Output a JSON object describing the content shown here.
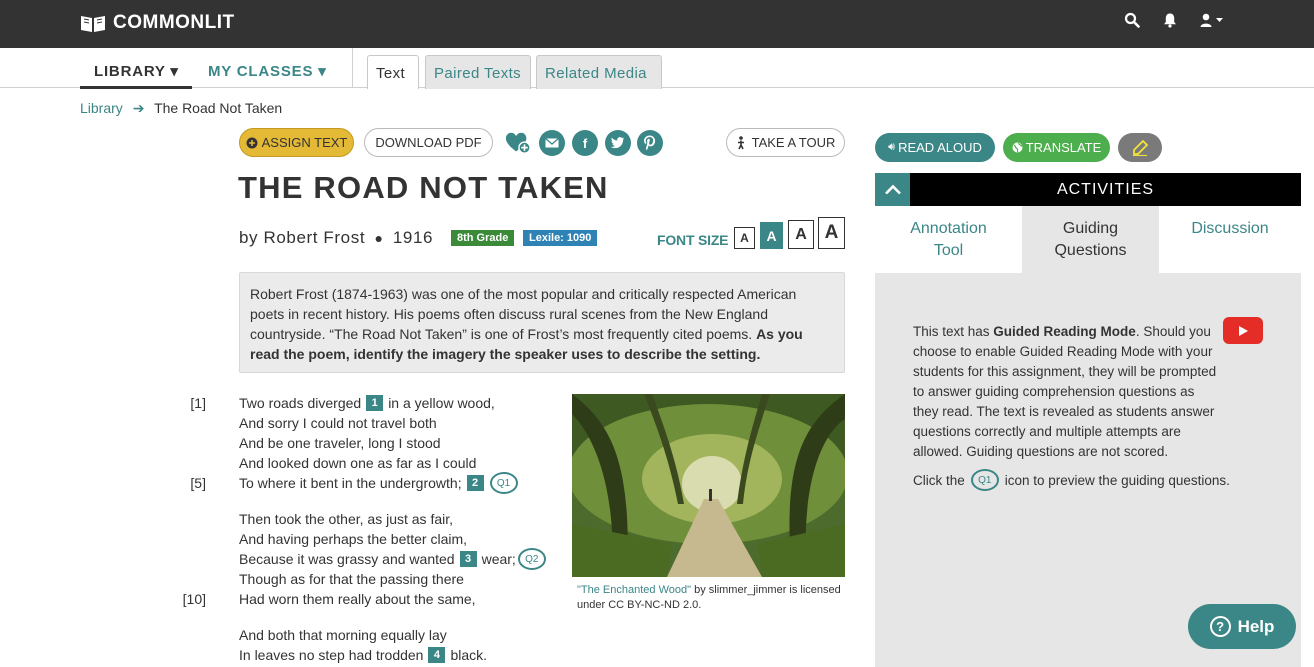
{
  "header": {
    "logo_text": "COMMONLIT",
    "icons": [
      "search-icon",
      "bell-icon",
      "user-icon"
    ]
  },
  "nav": {
    "library": "LIBRARY",
    "my_classes": "MY CLASSES",
    "tabs": [
      "Text",
      "Paired Texts",
      "Related Media"
    ]
  },
  "breadcrumb": {
    "library": "Library",
    "current": "The Road Not Taken"
  },
  "toolbar": {
    "assign": "ASSIGN TEXT",
    "download": "DOWNLOAD PDF",
    "tour": "TAKE A TOUR",
    "social": [
      "heart-plus-icon",
      "email-icon",
      "facebook-icon",
      "twitter-icon",
      "pinterest-icon"
    ]
  },
  "text": {
    "title": "THE ROAD NOT TAKEN",
    "byline": "by Robert Frost",
    "year": "1916",
    "grade": "8th Grade",
    "lexile": "Lexile: 1090",
    "font_size_label": "FONT SIZE",
    "font_size_options": [
      "A",
      "A",
      "A",
      "A"
    ],
    "intro_plain": "Robert Frost (1874-1963) was one of the most popular and critically respected American poets in recent history. His poems often discuss rural scenes from the New England countryside. “The Road Not Taken” is one of Frost’s most frequently cited poems. ",
    "intro_bold": "As you read the poem, identify the imagery the speaker uses to describe the setting."
  },
  "poem": {
    "line_numbers": [
      "[1]",
      "[5]",
      "[10]"
    ],
    "lines": [
      {
        "before": "Two roads diverged",
        "vocab": "1",
        "after": "in a yellow wood,"
      },
      {
        "before": "And sorry I could not travel both"
      },
      {
        "before": "And be one traveler, long I stood"
      },
      {
        "before": "And looked down one as far as I could"
      },
      {
        "before": "To where it bent in the undergrowth;",
        "vocab": "2",
        "question": "Q1"
      },
      {
        "before": "Then took the other, as just as fair,"
      },
      {
        "before": "And having perhaps the better claim,"
      },
      {
        "before": "Because it was grassy and wanted",
        "vocab": "3",
        "after": "wear;",
        "question": "Q2"
      },
      {
        "before": "Though as for that the passing there"
      },
      {
        "before": "Had worn them really about the same,"
      },
      {
        "before": "And both that morning equally lay"
      },
      {
        "before": "In leaves no step had trodden",
        "vocab": "4",
        "after": "black."
      }
    ]
  },
  "image": {
    "caption_link": "\"The Enchanted Wood\"",
    "caption_rest": " by slimmer_jimmer is licensed under CC BY-NC-ND 2.0."
  },
  "tools": {
    "read_aloud": "READ ALOUD",
    "translate": "TRANSLATE"
  },
  "activities": {
    "header": "ACTIVITIES",
    "tabs": [
      "Annotation Tool",
      "Guiding Questions",
      "Discussion"
    ],
    "tab_lines": [
      [
        "Annotation",
        "Tool"
      ],
      [
        "Guiding",
        "Questions"
      ],
      [
        "Discussion"
      ]
    ],
    "gr_pre": "This text has ",
    "gr_bold": "Guided Reading Mode",
    "gr_post": ". Should you choose to enable Guided Reading Mode with your students for this assignment, they will be prompted to answer guiding comprehension questions as they read. The text is revealed as students answer questions correctly and multiple attempts are allowed. Guiding questions are not scored.",
    "click_pre": "Click the",
    "click_icon": "Q1",
    "click_post": "icon to preview the guiding questions."
  },
  "help": {
    "label": "Help"
  },
  "colors": {
    "teal": "#3b8686",
    "topbar": "#333333",
    "assign": "#e3b935",
    "translate": "#4cae4c",
    "panel": "#e6e6e6"
  }
}
